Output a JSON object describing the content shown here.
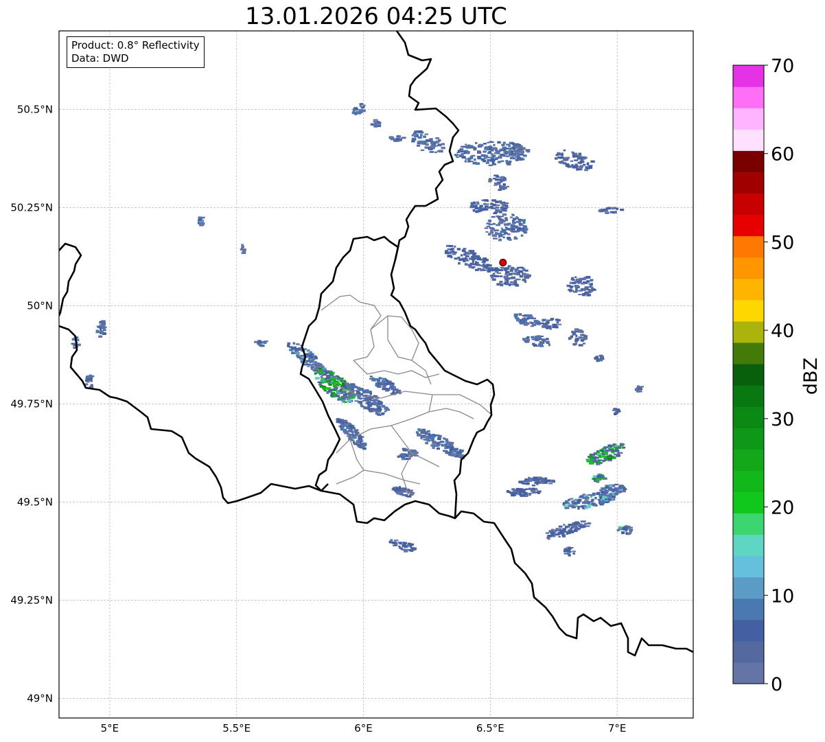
{
  "title": "13.01.2026 04:25 UTC",
  "info": {
    "product": "Product: 0.8° Reflectivity",
    "source": "Data: DWD"
  },
  "map": {
    "lon_range": [
      4.8,
      7.3
    ],
    "lat_range": [
      48.95,
      50.7
    ],
    "lon_ticks": [
      {
        "value": 5.0,
        "label": "5°E"
      },
      {
        "value": 5.5,
        "label": "5.5°E"
      },
      {
        "value": 6.0,
        "label": "6°E"
      },
      {
        "value": 6.5,
        "label": "6.5°E"
      },
      {
        "value": 7.0,
        "label": "7°E"
      }
    ],
    "lat_ticks": [
      {
        "value": 49.0,
        "label": "49°N"
      },
      {
        "value": 49.25,
        "label": "49.25°N"
      },
      {
        "value": 49.5,
        "label": "49.5°N"
      },
      {
        "value": 49.75,
        "label": "49.75°N"
      },
      {
        "value": 50.0,
        "label": "50°N"
      },
      {
        "value": 50.25,
        "label": "50.25°N"
      },
      {
        "value": 50.5,
        "label": "50.5°N"
      }
    ],
    "grid": true,
    "radar_site": {
      "lon": 6.55,
      "lat": 50.11,
      "color": "#e00000"
    }
  },
  "colorbar": {
    "label": "dBZ",
    "min": 0,
    "max": 70,
    "step": 2.5,
    "tick_values": [
      0,
      10,
      20,
      30,
      40,
      50,
      60,
      70
    ],
    "tick_labels": [
      "0",
      "10",
      "20",
      "30",
      "40",
      "50",
      "60",
      "70"
    ],
    "colors": [
      "#6474a6",
      "#5369a0",
      "#4560a2",
      "#4a78b0",
      "#5a9cc5",
      "#64c0dc",
      "#5fd6c4",
      "#3cd670",
      "#10c81c",
      "#12b81a",
      "#12a81a",
      "#0e9818",
      "#0c8814",
      "#0a7810",
      "#08600c",
      "#447a08",
      "#aab40a",
      "#ffd700",
      "#ffb400",
      "#ff9600",
      "#ff7800",
      "#e60000",
      "#c80000",
      "#a00000",
      "#7a0000",
      "#ffe0ff",
      "#ffb4ff",
      "#ff6ef6",
      "#e632e6"
    ]
  }
}
